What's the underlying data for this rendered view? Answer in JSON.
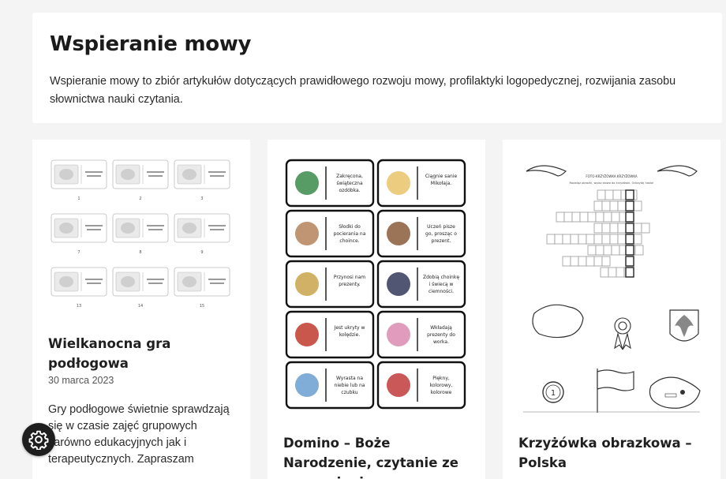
{
  "header": {
    "title": "Wspieranie mowy",
    "description": "Wspieranie mowy to zbiór artykułów dotyczących prawidłowego rozwoju mowy, profilaktyki logopedycznej, rozwijania zasobu słownictwa nauki czytania."
  },
  "posts": [
    {
      "title": "Wielkanocna gra podłogowa",
      "date": "30 marca 2023",
      "excerpt": "Gry podłogowe świetnie sprawdzają się w czasie zajęć grupowych zarówno edukacyjnych jak i terapeutycznych. Zapraszam",
      "thumb_numbers": [
        "1",
        "2",
        "3",
        "7",
        "8",
        "9",
        "13",
        "14",
        "15"
      ]
    },
    {
      "title": "Domino – Boże Narodzenie, czytanie ze zrozumieniem,",
      "thumb_texts": [
        "Zakręcona, świąteczna ozdóbka.",
        "Ciągnie sanie Mikołaja.",
        "Słodki do pocierania na choince.",
        "Uczeń pisze go, prosząc o prezent.",
        "Przynosi nam prezenty.",
        "Zdobią choinkę i świecą w ciemności.",
        "Jest ukryty w kolędzie.",
        "Wkładają prezenty do worka.",
        "Wyrasta na niebie lub na czubku choinki.",
        "Piękny, kolorowy, kolorowe drzewko."
      ]
    },
    {
      "title": "Krzyżówka obrazkowa – Polska",
      "thumb_heading": "FOTO-KRZYŻÓWKA KRZYŻÓWKA",
      "thumb_subheading": "Rozwiąż obrazki, wpisz słowo do krzyżówki. Odczytaj hasło!"
    }
  ],
  "settings_button": {
    "icon": "gear-icon"
  }
}
